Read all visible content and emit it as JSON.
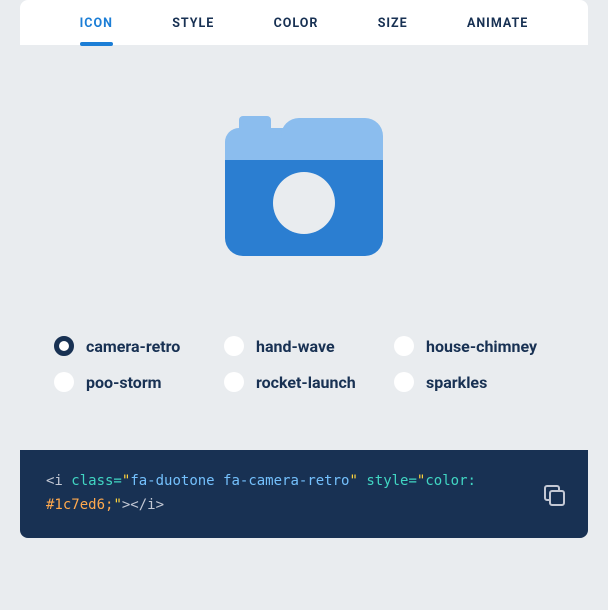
{
  "tabs": {
    "icon": "ICON",
    "style": "STYLE",
    "color": "COLOR",
    "size": "SIZE",
    "animate": "ANIMATE"
  },
  "preview_icon": "camera-retro",
  "options": {
    "camera_retro": "camera-retro",
    "hand_wave": "hand-wave",
    "house_chimney": "house-chimney",
    "poo_storm": "poo-storm",
    "rocket_launch": "rocket-launch",
    "sparkles": "sparkles"
  },
  "code": {
    "open1": "<i",
    "class_attr": " class=",
    "q1": "\"",
    "class_val": "fa-duotone fa-camera-retro",
    "q2": "\"",
    "style_attr": " style=",
    "q3": "\"",
    "style_key": "color: ",
    "color_val": "#1c7ed6;",
    "q4": "\"",
    "close": "></i>"
  }
}
